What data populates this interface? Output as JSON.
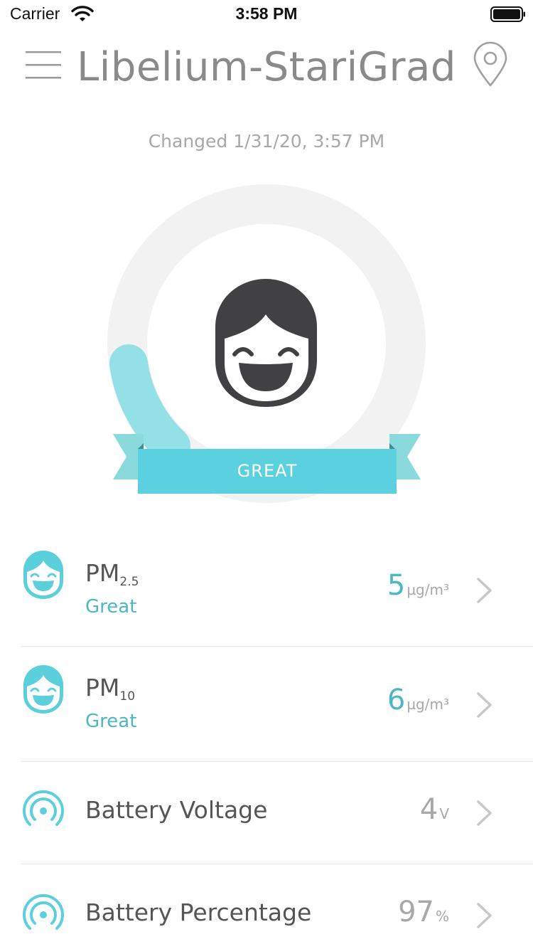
{
  "status_bar": {
    "carrier": "Carrier",
    "time": "3:58 PM"
  },
  "nav": {
    "title": "Libelium-StariGrad"
  },
  "changed": "Changed  1/31/20, 3:57 PM",
  "gauge": {
    "label": "GREAT",
    "accent_color": "#5bd0df",
    "ribbon_color": "#8ad9dc",
    "level_fraction": 0.18
  },
  "readings": [
    {
      "name": "PM",
      "subscript": "2.5",
      "status": "Great",
      "value": "5",
      "unit": "µg/m³",
      "icon": "happy-face-icon"
    },
    {
      "name": "PM",
      "subscript": "10",
      "status": "Great",
      "value": "6",
      "unit": "µg/m³",
      "icon": "happy-face-icon"
    },
    {
      "name": "Battery Voltage",
      "value": "4",
      "unit": "V",
      "icon": "signal-icon"
    },
    {
      "name": "Battery Percentage",
      "value": "97",
      "unit": "%",
      "icon": "signal-icon"
    }
  ],
  "colors": {
    "teal": "#4bb8c4",
    "face_dark": "#414143",
    "ring_gray": "#f2f2f2"
  }
}
